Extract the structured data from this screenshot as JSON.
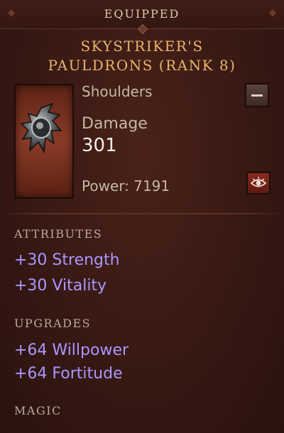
{
  "header": {
    "label": "EQUIPPED"
  },
  "item": {
    "name_line1": "SKYSTRIKER'S",
    "name_line2": "PAULDRONS (RANK 8)",
    "slot": "Shoulders",
    "damage_label": "Damage",
    "damage_value": "301",
    "power": "Power: 7191",
    "name_color": "#e7b46c"
  },
  "icons": {
    "compare": "compare-icon",
    "inspect": "eye-icon",
    "item": "pauldron-icon"
  },
  "attributes": {
    "title": "ATTRIBUTES",
    "lines": [
      "+30 Strength",
      "+30 Vitality"
    ]
  },
  "upgrades": {
    "title": "UPGRADES",
    "lines": [
      "+64 Willpower",
      "+64 Fortitude"
    ]
  },
  "magic": {
    "title": "MAGIC"
  },
  "colors": {
    "stat": "#a997ff",
    "background": "#3a1a14"
  }
}
